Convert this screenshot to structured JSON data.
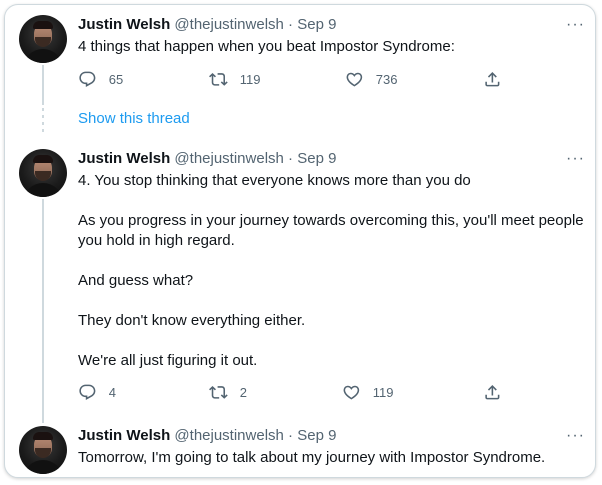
{
  "tweets": [
    {
      "author_name": "Justin Welsh",
      "handle": "@thejustinwelsh",
      "separator": "·",
      "date": "Sep 9",
      "text": [
        "4 things that happen when you beat Impostor Syndrome:"
      ],
      "replies": "65",
      "retweets": "119",
      "likes": "736"
    },
    {
      "author_name": "Justin Welsh",
      "handle": "@thejustinwelsh",
      "separator": "·",
      "date": "Sep 9",
      "text": [
        "4. You stop thinking that everyone knows more than you do",
        "As you progress in your journey towards overcoming this, you'll meet people you hold in high regard.",
        "And guess what?",
        "They don't know everything either.",
        "We're all just figuring it out."
      ],
      "replies": "4",
      "retweets": "2",
      "likes": "119"
    },
    {
      "author_name": "Justin Welsh",
      "handle": "@thejustinwelsh",
      "separator": "·",
      "date": "Sep 9",
      "text": [
        "Tomorrow, I'm going to talk about my journey with Impostor Syndrome."
      ]
    }
  ],
  "show_thread_label": "Show this thread",
  "more_label": "···",
  "icons": {
    "reply": "reply-icon",
    "retweet": "retweet-icon",
    "like": "heart-icon",
    "share": "share-icon",
    "more": "more-icon"
  },
  "colors": {
    "link": "#1d9bf0",
    "secondary_text": "#536471",
    "thread_line": "#cfd9de"
  }
}
